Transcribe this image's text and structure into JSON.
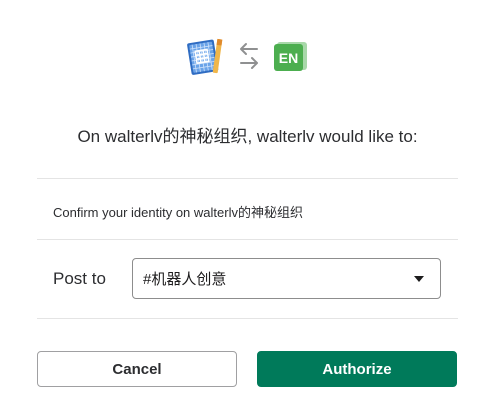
{
  "icons": {
    "app": "blueprint-app-icon",
    "swap": "swap-arrows-icon",
    "workspace": "en-app-icon",
    "workspace_text": "EN"
  },
  "heading": "On walterlv的神秘组织, walterlv would like to:",
  "permission": "Confirm your identity on walterlv的神秘组织",
  "post_to": {
    "label": "Post to",
    "selected_channel": "#机器人创意"
  },
  "buttons": {
    "cancel": "Cancel",
    "authorize": "Authorize"
  },
  "colors": {
    "authorize_bg": "#007a5a",
    "en_icon": "#4cae4f",
    "app_icon": "#3b7fd3"
  }
}
